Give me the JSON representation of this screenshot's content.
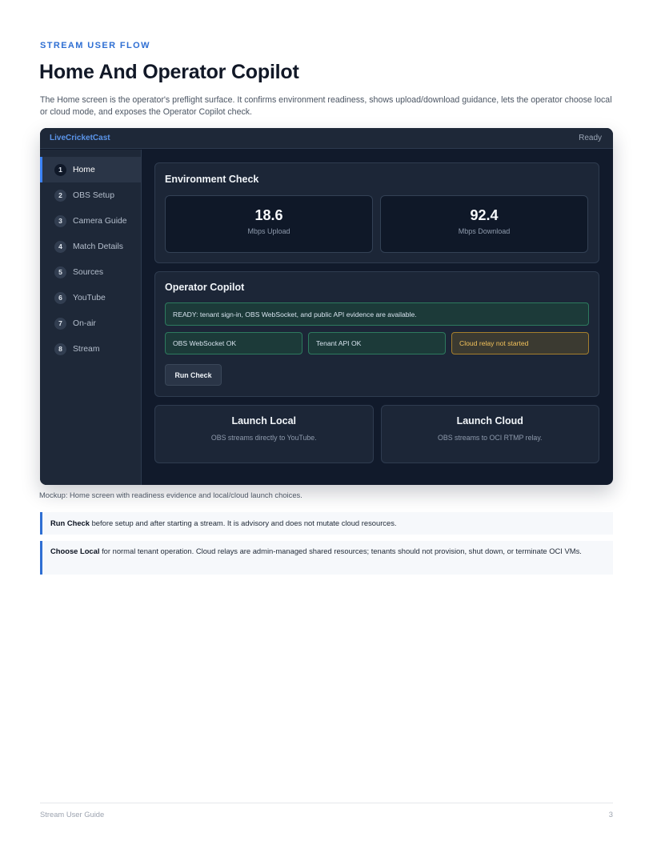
{
  "doc": {
    "eyebrow": "STREAM USER FLOW",
    "title": "Home And Operator Copilot",
    "intro": "The Home screen is the operator's preflight surface. It confirms environment readiness, shows upload/download guidance, lets the operator choose local or cloud mode, and exposes the Operator Copilot check."
  },
  "app": {
    "name": "LiveCricketCast",
    "status": "Ready"
  },
  "sidebar": {
    "items": [
      {
        "num": "1",
        "label": "Home",
        "active": true
      },
      {
        "num": "2",
        "label": "OBS Setup"
      },
      {
        "num": "3",
        "label": "Camera Guide"
      },
      {
        "num": "4",
        "label": "Match Details"
      },
      {
        "num": "5",
        "label": "Sources"
      },
      {
        "num": "6",
        "label": "YouTube"
      },
      {
        "num": "7",
        "label": "On-air"
      },
      {
        "num": "8",
        "label": "Stream"
      }
    ]
  },
  "environment": {
    "title": "Environment Check",
    "upload": {
      "value": "18.6",
      "unit": "Mbps Upload"
    },
    "download": {
      "value": "92.4",
      "unit": "Mbps Download"
    }
  },
  "copilot": {
    "title": "Operator Copilot",
    "ready_message": "READY: tenant sign-in, OBS WebSocket, and public API evidence are available.",
    "checks": [
      {
        "label": "OBS WebSocket OK",
        "status": "ok"
      },
      {
        "label": "Tenant API OK",
        "status": "ok"
      },
      {
        "label": "Cloud relay not started",
        "status": "warn"
      }
    ],
    "run_label": "Run Check"
  },
  "launch": {
    "local": {
      "title": "Launch Local",
      "desc": "OBS streams directly to YouTube."
    },
    "cloud": {
      "title": "Launch Cloud",
      "desc": "OBS streams to OCI RTMP relay."
    }
  },
  "caption": "Mockup: Home screen with readiness evidence and local/cloud launch choices.",
  "callouts": [
    {
      "strong": "Run Check",
      "text": " before setup and after starting a stream. It is advisory and does not mutate cloud resources."
    },
    {
      "strong": "Choose Local",
      "text": " for normal tenant operation. Cloud relays are admin-managed shared resources; tenants should not provision, shut down, or terminate OCI VMs."
    }
  ],
  "footer": {
    "left": "Stream User Guide",
    "page": "3"
  },
  "colors": {
    "accent": "#2f6fd3",
    "app_bg": "#111a2b",
    "ok_border": "#2d7a5e",
    "warn_text": "#f2c15a"
  }
}
